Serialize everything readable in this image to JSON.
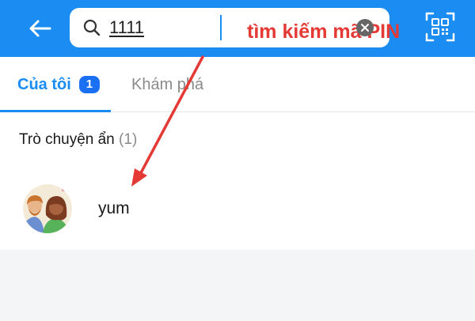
{
  "header": {
    "back_icon": "arrow-left-icon",
    "search": {
      "icon": "search-icon",
      "value": "1111",
      "clear_icon": "clear-circle-icon"
    },
    "qr_icon": "qr-scan-icon",
    "background": "#1a8cf2"
  },
  "annotation": {
    "text": "tìm kiếm mã PIN",
    "color": "#e53935"
  },
  "tabs": [
    {
      "label": "Của tôi",
      "badge": "1",
      "active": true
    },
    {
      "label": "Khám phá",
      "active": false
    }
  ],
  "section": {
    "title": "Trò chuyện ẩn",
    "count": "(1)"
  },
  "chats": [
    {
      "name": "yum",
      "avatar": "couple-avatar"
    }
  ]
}
